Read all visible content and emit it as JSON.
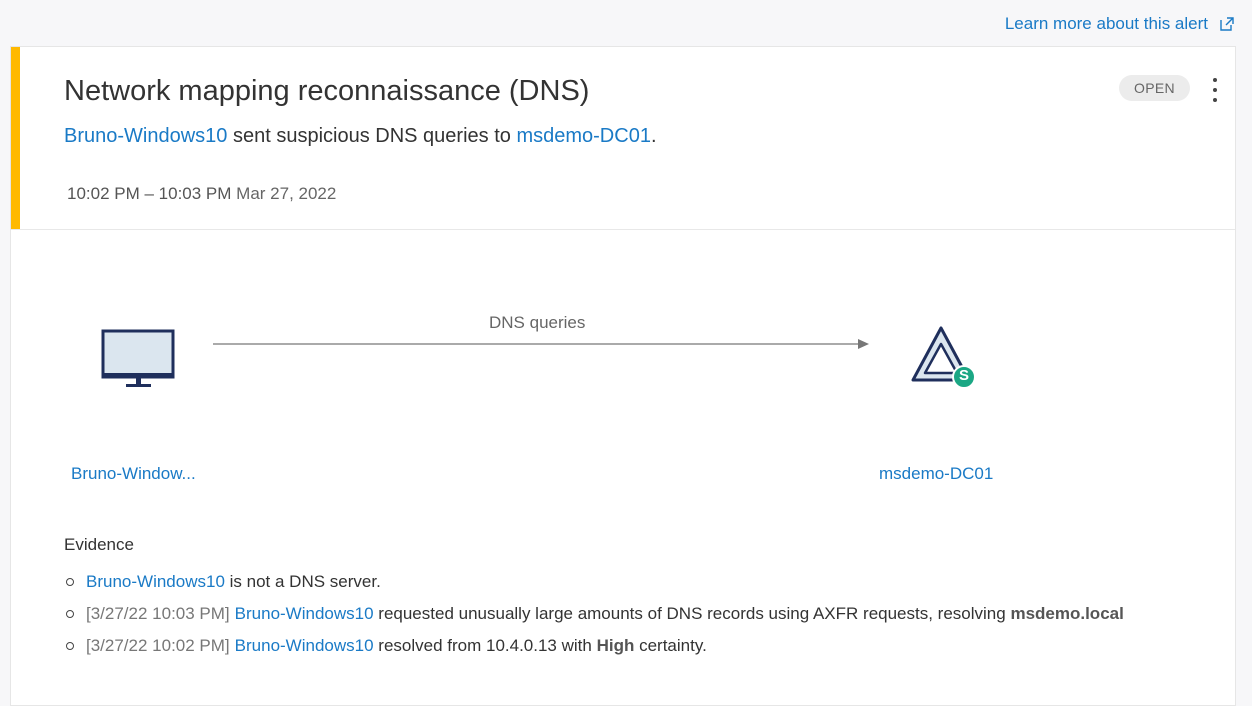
{
  "header": {
    "learn_more": "Learn more about this alert"
  },
  "alert": {
    "title": "Network mapping reconnaissance (DNS)",
    "status": "OPEN",
    "subtitle": {
      "source": "Bruno-Windows10",
      "text": " sent suspicious DNS queries to ",
      "target": "msdemo-DC01",
      "end": "."
    },
    "time_range": "10:02 PM – 10:03 PM",
    "date": "Mar 27, 2022",
    "severity_color": "#ffb900"
  },
  "diagram": {
    "source_label": "Bruno-Window...",
    "edge_label": "DNS queries",
    "target_label": "msdemo-DC01",
    "source_icon": "computer-monitor-icon",
    "target_icon": "domain-controller-icon",
    "target_badge": "S"
  },
  "evidence": {
    "title": "Evidence",
    "items": [
      {
        "host": "Bruno-Windows10",
        "text": " is not a DNS server."
      },
      {
        "timestamp": "[3/27/22 10:03 PM]",
        "host": "Bruno-Windows10",
        "text": " requested unusually large amounts of DNS records using AXFR requests, resolving ",
        "bold": "msdemo.local"
      },
      {
        "timestamp": "[3/27/22 10:02 PM]",
        "host": "Bruno-Windows10",
        "text": " resolved from 10.4.0.13 with ",
        "bold": "High",
        "end": " certainty."
      }
    ]
  }
}
